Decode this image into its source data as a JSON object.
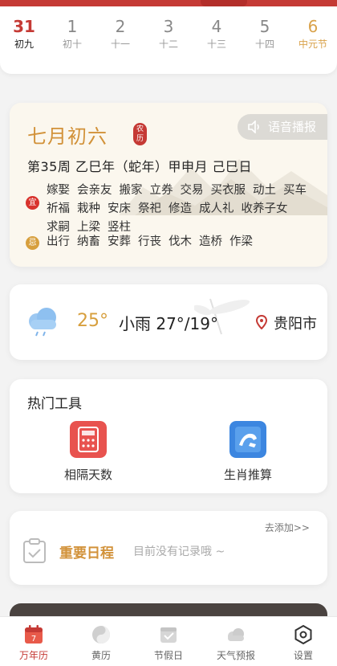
{
  "days": [
    {
      "num": "31",
      "sub": "初九",
      "state": "active"
    },
    {
      "num": "1",
      "sub": "初十",
      "state": ""
    },
    {
      "num": "2",
      "sub": "十一",
      "state": ""
    },
    {
      "num": "3",
      "sub": "十二",
      "state": ""
    },
    {
      "num": "4",
      "sub": "十三",
      "state": ""
    },
    {
      "num": "5",
      "sub": "十四",
      "state": ""
    },
    {
      "num": "6",
      "sub": "中元节",
      "state": "festival"
    }
  ],
  "almanac": {
    "lunar_date": "七月初六",
    "calendar_badge": "农历",
    "voice_label": "语音播报",
    "ganzhi": "第35周  乙巳年（蛇年）甲申月 己巳日",
    "yi_label": "宜",
    "yi_items": [
      "嫁娶",
      "会亲友",
      "搬家",
      "立券",
      "交易",
      "买衣服",
      "动土",
      "买车",
      "祈福",
      "栽种",
      "安床",
      "祭祀",
      "修造",
      "成人礼",
      "收养子女",
      "求嗣",
      "上梁",
      "竖柱"
    ],
    "ji_label": "忌",
    "ji_items": [
      "出行",
      "纳畜",
      "安葬",
      "行丧",
      "伐木",
      "造桥",
      "作梁"
    ]
  },
  "weather": {
    "temp": "25°",
    "condition": "小雨 27°/19°",
    "city": "贵阳市",
    "icon": "light-rain-cloud-icon"
  },
  "tools": {
    "title": "热门工具",
    "items": [
      {
        "label": "相隔天数",
        "icon": "calculator-icon",
        "color": "#e8534f"
      },
      {
        "label": "生肖推算",
        "icon": "tiger-zodiac-icon",
        "color": "#3c86e0"
      }
    ]
  },
  "schedule": {
    "add_label": "去添加>>",
    "title": "重要日程",
    "empty_text": "目前没有记录哦 ~"
  },
  "tabbar": [
    {
      "label": "万年历",
      "icon": "calendar-icon",
      "active": true,
      "day": "7"
    },
    {
      "label": "黄历",
      "icon": "yin-yang-icon",
      "active": false
    },
    {
      "label": "节假日",
      "icon": "holiday-calendar-icon",
      "active": false
    },
    {
      "label": "天气预报",
      "icon": "cloud-icon",
      "active": false
    },
    {
      "label": "设置",
      "icon": "settings-hexagon-icon",
      "active": false
    }
  ],
  "colors": {
    "accent_red": "#c53a35",
    "gold": "#d2923a",
    "ji_orange": "#d79f3d"
  }
}
